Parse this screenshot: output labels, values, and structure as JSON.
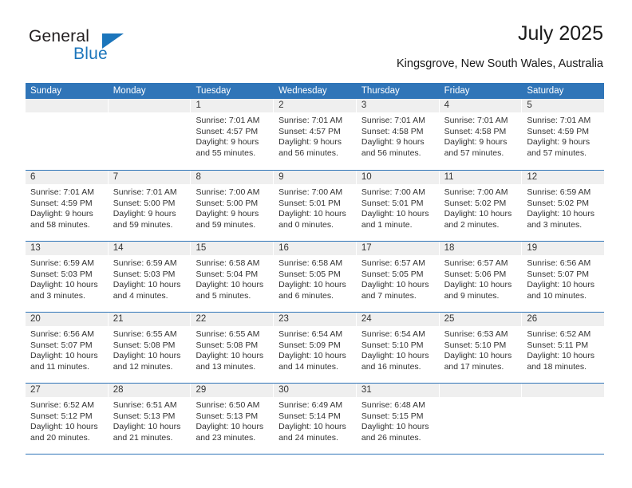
{
  "brand": {
    "name_part1": "General",
    "name_part2": "Blue",
    "triangle_icon": "triangle-icon",
    "color_primary": "#1b75bb",
    "color_text": "#231f20"
  },
  "header": {
    "title": "July 2025",
    "subtitle": "Kingsgrove, New South Wales, Australia"
  },
  "calendar": {
    "accent_color": "#3075b8",
    "daynum_band_color": "#efefef",
    "weekdays": [
      "Sunday",
      "Monday",
      "Tuesday",
      "Wednesday",
      "Thursday",
      "Friday",
      "Saturday"
    ],
    "labels": {
      "sunrise": "Sunrise:",
      "sunset": "Sunset:",
      "daylight": "Daylight:"
    },
    "weeks": [
      [
        {
          "day": "",
          "sunrise": "",
          "sunset": "",
          "daylight_1": "",
          "daylight_2": ""
        },
        {
          "day": "",
          "sunrise": "",
          "sunset": "",
          "daylight_1": "",
          "daylight_2": ""
        },
        {
          "day": "1",
          "sunrise": "Sunrise: 7:01 AM",
          "sunset": "Sunset: 4:57 PM",
          "daylight_1": "Daylight: 9 hours",
          "daylight_2": "and 55 minutes."
        },
        {
          "day": "2",
          "sunrise": "Sunrise: 7:01 AM",
          "sunset": "Sunset: 4:57 PM",
          "daylight_1": "Daylight: 9 hours",
          "daylight_2": "and 56 minutes."
        },
        {
          "day": "3",
          "sunrise": "Sunrise: 7:01 AM",
          "sunset": "Sunset: 4:58 PM",
          "daylight_1": "Daylight: 9 hours",
          "daylight_2": "and 56 minutes."
        },
        {
          "day": "4",
          "sunrise": "Sunrise: 7:01 AM",
          "sunset": "Sunset: 4:58 PM",
          "daylight_1": "Daylight: 9 hours",
          "daylight_2": "and 57 minutes."
        },
        {
          "day": "5",
          "sunrise": "Sunrise: 7:01 AM",
          "sunset": "Sunset: 4:59 PM",
          "daylight_1": "Daylight: 9 hours",
          "daylight_2": "and 57 minutes."
        }
      ],
      [
        {
          "day": "6",
          "sunrise": "Sunrise: 7:01 AM",
          "sunset": "Sunset: 4:59 PM",
          "daylight_1": "Daylight: 9 hours",
          "daylight_2": "and 58 minutes."
        },
        {
          "day": "7",
          "sunrise": "Sunrise: 7:01 AM",
          "sunset": "Sunset: 5:00 PM",
          "daylight_1": "Daylight: 9 hours",
          "daylight_2": "and 59 minutes."
        },
        {
          "day": "8",
          "sunrise": "Sunrise: 7:00 AM",
          "sunset": "Sunset: 5:00 PM",
          "daylight_1": "Daylight: 9 hours",
          "daylight_2": "and 59 minutes."
        },
        {
          "day": "9",
          "sunrise": "Sunrise: 7:00 AM",
          "sunset": "Sunset: 5:01 PM",
          "daylight_1": "Daylight: 10 hours",
          "daylight_2": "and 0 minutes."
        },
        {
          "day": "10",
          "sunrise": "Sunrise: 7:00 AM",
          "sunset": "Sunset: 5:01 PM",
          "daylight_1": "Daylight: 10 hours",
          "daylight_2": "and 1 minute."
        },
        {
          "day": "11",
          "sunrise": "Sunrise: 7:00 AM",
          "sunset": "Sunset: 5:02 PM",
          "daylight_1": "Daylight: 10 hours",
          "daylight_2": "and 2 minutes."
        },
        {
          "day": "12",
          "sunrise": "Sunrise: 6:59 AM",
          "sunset": "Sunset: 5:02 PM",
          "daylight_1": "Daylight: 10 hours",
          "daylight_2": "and 3 minutes."
        }
      ],
      [
        {
          "day": "13",
          "sunrise": "Sunrise: 6:59 AM",
          "sunset": "Sunset: 5:03 PM",
          "daylight_1": "Daylight: 10 hours",
          "daylight_2": "and 3 minutes."
        },
        {
          "day": "14",
          "sunrise": "Sunrise: 6:59 AM",
          "sunset": "Sunset: 5:03 PM",
          "daylight_1": "Daylight: 10 hours",
          "daylight_2": "and 4 minutes."
        },
        {
          "day": "15",
          "sunrise": "Sunrise: 6:58 AM",
          "sunset": "Sunset: 5:04 PM",
          "daylight_1": "Daylight: 10 hours",
          "daylight_2": "and 5 minutes."
        },
        {
          "day": "16",
          "sunrise": "Sunrise: 6:58 AM",
          "sunset": "Sunset: 5:05 PM",
          "daylight_1": "Daylight: 10 hours",
          "daylight_2": "and 6 minutes."
        },
        {
          "day": "17",
          "sunrise": "Sunrise: 6:57 AM",
          "sunset": "Sunset: 5:05 PM",
          "daylight_1": "Daylight: 10 hours",
          "daylight_2": "and 7 minutes."
        },
        {
          "day": "18",
          "sunrise": "Sunrise: 6:57 AM",
          "sunset": "Sunset: 5:06 PM",
          "daylight_1": "Daylight: 10 hours",
          "daylight_2": "and 9 minutes."
        },
        {
          "day": "19",
          "sunrise": "Sunrise: 6:56 AM",
          "sunset": "Sunset: 5:07 PM",
          "daylight_1": "Daylight: 10 hours",
          "daylight_2": "and 10 minutes."
        }
      ],
      [
        {
          "day": "20",
          "sunrise": "Sunrise: 6:56 AM",
          "sunset": "Sunset: 5:07 PM",
          "daylight_1": "Daylight: 10 hours",
          "daylight_2": "and 11 minutes."
        },
        {
          "day": "21",
          "sunrise": "Sunrise: 6:55 AM",
          "sunset": "Sunset: 5:08 PM",
          "daylight_1": "Daylight: 10 hours",
          "daylight_2": "and 12 minutes."
        },
        {
          "day": "22",
          "sunrise": "Sunrise: 6:55 AM",
          "sunset": "Sunset: 5:08 PM",
          "daylight_1": "Daylight: 10 hours",
          "daylight_2": "and 13 minutes."
        },
        {
          "day": "23",
          "sunrise": "Sunrise: 6:54 AM",
          "sunset": "Sunset: 5:09 PM",
          "daylight_1": "Daylight: 10 hours",
          "daylight_2": "and 14 minutes."
        },
        {
          "day": "24",
          "sunrise": "Sunrise: 6:54 AM",
          "sunset": "Sunset: 5:10 PM",
          "daylight_1": "Daylight: 10 hours",
          "daylight_2": "and 16 minutes."
        },
        {
          "day": "25",
          "sunrise": "Sunrise: 6:53 AM",
          "sunset": "Sunset: 5:10 PM",
          "daylight_1": "Daylight: 10 hours",
          "daylight_2": "and 17 minutes."
        },
        {
          "day": "26",
          "sunrise": "Sunrise: 6:52 AM",
          "sunset": "Sunset: 5:11 PM",
          "daylight_1": "Daylight: 10 hours",
          "daylight_2": "and 18 minutes."
        }
      ],
      [
        {
          "day": "27",
          "sunrise": "Sunrise: 6:52 AM",
          "sunset": "Sunset: 5:12 PM",
          "daylight_1": "Daylight: 10 hours",
          "daylight_2": "and 20 minutes."
        },
        {
          "day": "28",
          "sunrise": "Sunrise: 6:51 AM",
          "sunset": "Sunset: 5:13 PM",
          "daylight_1": "Daylight: 10 hours",
          "daylight_2": "and 21 minutes."
        },
        {
          "day": "29",
          "sunrise": "Sunrise: 6:50 AM",
          "sunset": "Sunset: 5:13 PM",
          "daylight_1": "Daylight: 10 hours",
          "daylight_2": "and 23 minutes."
        },
        {
          "day": "30",
          "sunrise": "Sunrise: 6:49 AM",
          "sunset": "Sunset: 5:14 PM",
          "daylight_1": "Daylight: 10 hours",
          "daylight_2": "and 24 minutes."
        },
        {
          "day": "31",
          "sunrise": "Sunrise: 6:48 AM",
          "sunset": "Sunset: 5:15 PM",
          "daylight_1": "Daylight: 10 hours",
          "daylight_2": "and 26 minutes."
        },
        {
          "day": "",
          "sunrise": "",
          "sunset": "",
          "daylight_1": "",
          "daylight_2": ""
        },
        {
          "day": "",
          "sunrise": "",
          "sunset": "",
          "daylight_1": "",
          "daylight_2": ""
        }
      ]
    ]
  }
}
